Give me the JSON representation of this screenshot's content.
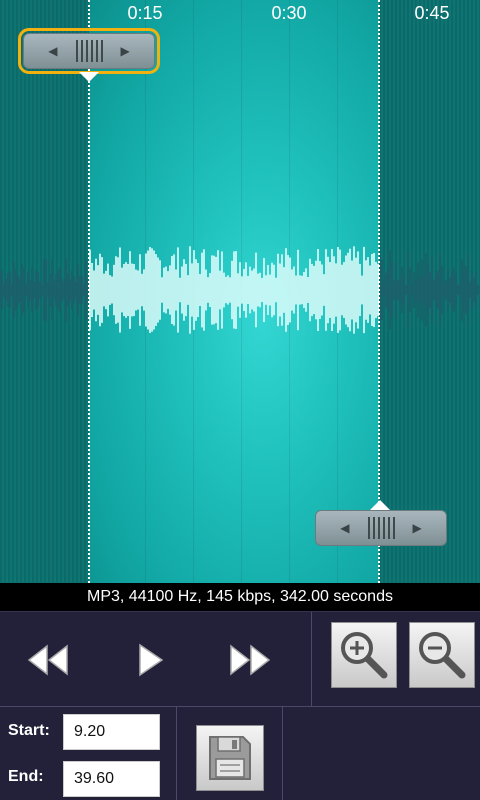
{
  "timeline": {
    "labels": [
      "0:15",
      "0:30",
      "0:45"
    ]
  },
  "info": {
    "text": "MP3, 44100 Hz, 145 kbps, 342.00 seconds"
  },
  "controls": {
    "rewind_icon": "rewind-icon",
    "play_icon": "play-icon",
    "forward_icon": "fast-forward-icon",
    "zoom_in_icon": "zoom-in-icon",
    "zoom_out_icon": "zoom-out-icon",
    "save_icon": "floppy-disk-icon"
  },
  "fields": {
    "start_label": "Start:",
    "start_value": "9.20",
    "end_label": "End:",
    "end_value": "39.60"
  },
  "colors": {
    "selection": "#1fc0bc",
    "handle_highlight": "#f2b10f",
    "panel_bg": "#23213a"
  }
}
